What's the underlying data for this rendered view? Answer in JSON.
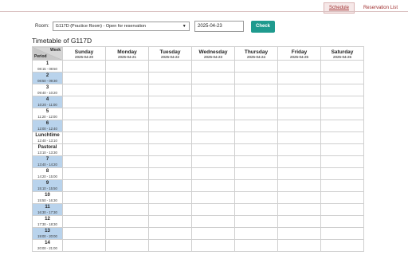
{
  "nav": {
    "schedule": "Schedule",
    "reservation_list": "Reservation List"
  },
  "form": {
    "room_label": "Room:",
    "room_value": "G117D (Practice Room) - Open for reservation",
    "date_value": "2025-04-23",
    "check_label": "Check"
  },
  "timetable": {
    "title": "Timetable of G117D",
    "corner_week": "Week",
    "corner_period": "Period",
    "days": [
      {
        "name": "Sunday",
        "date": "2025-04-20"
      },
      {
        "name": "Monday",
        "date": "2025-04-21"
      },
      {
        "name": "Tuesday",
        "date": "2025-04-22"
      },
      {
        "name": "Wednesday",
        "date": "2025-04-23"
      },
      {
        "name": "Thursday",
        "date": "2025-04-24"
      },
      {
        "name": "Friday",
        "date": "2025-04-25"
      },
      {
        "name": "Saturday",
        "date": "2025-04-26"
      }
    ],
    "periods": [
      {
        "name": "1",
        "time": "08:15 - 08:50",
        "shade": "white"
      },
      {
        "name": "2",
        "time": "08:50 - 09:30",
        "shade": "blue"
      },
      {
        "name": "3",
        "time": "09:40 - 10:20",
        "shade": "white"
      },
      {
        "name": "4",
        "time": "10:20 - 11:00",
        "shade": "blue"
      },
      {
        "name": "5",
        "time": "11:20 - 12:00",
        "shade": "white"
      },
      {
        "name": "6",
        "time": "12:00 - 12:40",
        "shade": "blue"
      },
      {
        "name": "Lunchtime",
        "time": "12:40 - 13:10",
        "shade": "white"
      },
      {
        "name": "Pastoral",
        "time": "13:10 - 13:30",
        "shade": "white"
      },
      {
        "name": "7",
        "time": "13:40 - 14:20",
        "shade": "blue"
      },
      {
        "name": "8",
        "time": "14:20 - 15:00",
        "shade": "white"
      },
      {
        "name": "9",
        "time": "15:10 - 15:50",
        "shade": "blue"
      },
      {
        "name": "10",
        "time": "15:50 - 16:30",
        "shade": "white"
      },
      {
        "name": "11",
        "time": "16:30 - 17:30",
        "shade": "blue"
      },
      {
        "name": "12",
        "time": "17:30 - 18:30",
        "shade": "white"
      },
      {
        "name": "13",
        "time": "19:00 - 20:00",
        "shade": "blue"
      },
      {
        "name": "14",
        "time": "20:00 - 21:00",
        "shade": "white"
      }
    ]
  }
}
